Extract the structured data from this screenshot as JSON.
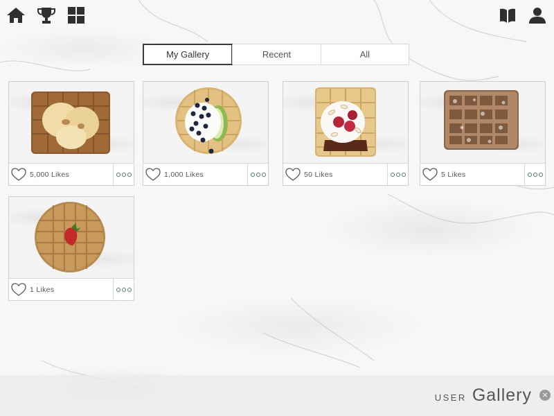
{
  "topbar": {
    "icons": [
      "home-icon",
      "trophy-icon",
      "grid-icon",
      "book-icon",
      "user-icon"
    ]
  },
  "tabs": [
    {
      "label": "My Gallery",
      "active": true
    },
    {
      "label": "Recent",
      "active": false
    },
    {
      "label": "All",
      "active": false
    }
  ],
  "cards": [
    {
      "likes_label": "5,000 Likes",
      "image": "waffle with apple chips"
    },
    {
      "likes_label": "1,000 Likes",
      "image": "round waffle with cream, blueberries and green apple"
    },
    {
      "likes_label": "50 Likes",
      "image": "waffle with cream, raspberries and almonds"
    },
    {
      "likes_label": "5 Likes",
      "image": "waffle with powdered sugar"
    },
    {
      "likes_label": "1 Likes",
      "image": "round waffle with strawberry"
    }
  ],
  "footer": {
    "prefix": "USER",
    "title": "Gallery",
    "close_glyph": "×"
  },
  "colors": {
    "accent_dots": "#4e7a6a",
    "active_tab_border": "#3a3a3a"
  }
}
